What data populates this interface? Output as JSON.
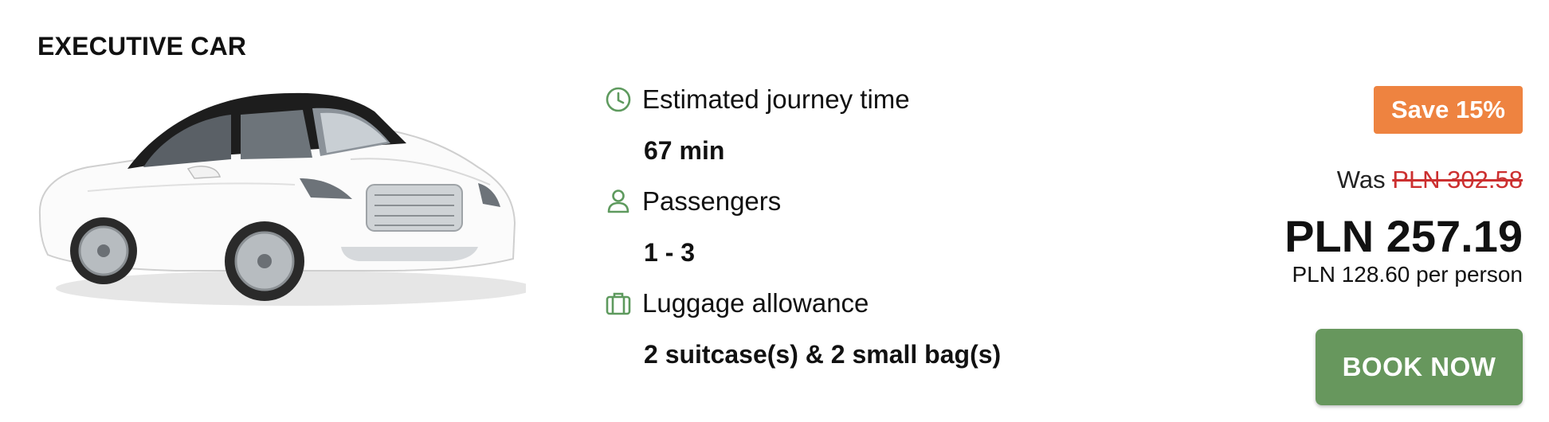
{
  "vehicle": {
    "title": "EXECUTIVE CAR",
    "image_icon": "white-sedan-car-image"
  },
  "details": {
    "journey": {
      "icon": "clock-icon",
      "label": "Estimated journey time",
      "value": "67 min"
    },
    "passengers": {
      "icon": "person-icon",
      "label": "Passengers",
      "value": "1 - 3"
    },
    "luggage": {
      "icon": "suitcase-icon",
      "label": "Luggage allowance",
      "value": "2 suitcase(s) & 2 small bag(s)"
    }
  },
  "pricing": {
    "save_badge": "Save 15%",
    "was_label": "Was",
    "was_price": "PLN 302.58",
    "price": "PLN 257.19",
    "per_person": "PLN 128.60 per person",
    "book_label": "BOOK NOW"
  },
  "colors": {
    "accent_green": "#67975d",
    "icon_green": "#5e9a5e",
    "badge_orange": "#ee8340",
    "strike_red": "#cc3030"
  }
}
